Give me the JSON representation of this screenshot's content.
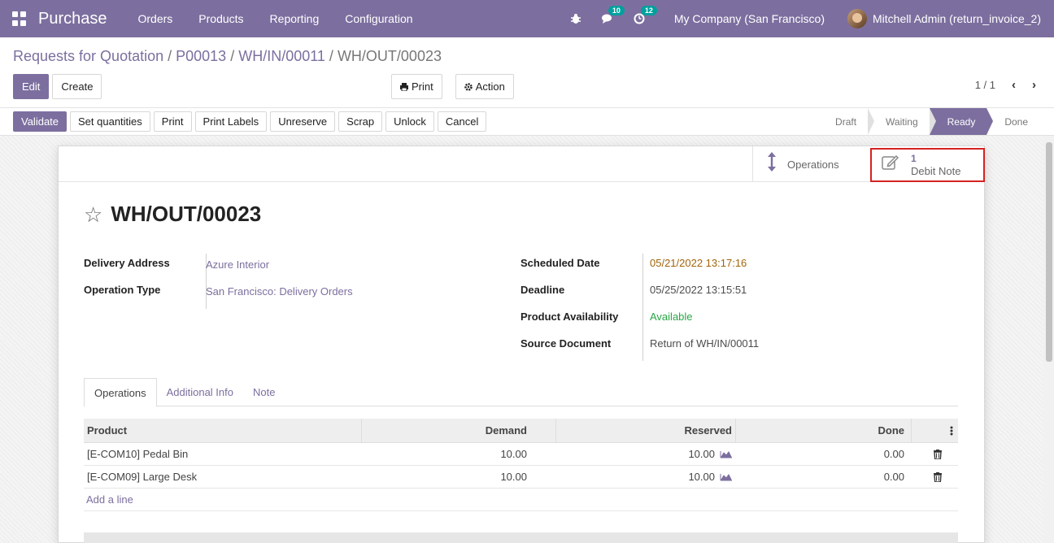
{
  "navbar": {
    "brand": "Purchase",
    "menu": [
      "Orders",
      "Products",
      "Reporting",
      "Configuration"
    ],
    "messages_count": "10",
    "activities_count": "12",
    "company": "My Company (San Francisco)",
    "user": "Mitchell Admin (return_invoice_2)"
  },
  "breadcrumb": [
    {
      "label": "Requests for Quotation"
    },
    {
      "label": "P00013"
    },
    {
      "label": "WH/IN/00011"
    },
    {
      "label": "WH/OUT/00023"
    }
  ],
  "control": {
    "edit": "Edit",
    "create": "Create",
    "print": "Print",
    "action": "Action",
    "pager": "1 / 1"
  },
  "status_buttons": {
    "validate": "Validate",
    "set_quantities": "Set quantities",
    "print": "Print",
    "print_labels": "Print Labels",
    "unreserve": "Unreserve",
    "scrap": "Scrap",
    "unlock": "Unlock",
    "cancel": "Cancel"
  },
  "stages": [
    "Draft",
    "Waiting",
    "Ready",
    "Done"
  ],
  "active_stage": "Ready",
  "smart_buttons": {
    "operations": "Operations",
    "debit_count": "1",
    "debit_label": "Debit Note"
  },
  "record": {
    "title": "WH/OUT/00023",
    "left": [
      {
        "label": "Delivery Address",
        "value": "Azure Interior"
      },
      {
        "label": "Operation Type",
        "value": "San Francisco: Delivery Orders"
      }
    ],
    "right": [
      {
        "label": "Scheduled Date",
        "value": "05/21/2022 13:17:16"
      },
      {
        "label": "Deadline",
        "value": "05/25/2022 13:15:51"
      },
      {
        "label": "Product Availability",
        "value": "Available"
      },
      {
        "label": "Source Document",
        "value": "Return of WH/IN/00011"
      }
    ]
  },
  "tabs": [
    "Operations",
    "Additional Info",
    "Note"
  ],
  "table": {
    "headers": {
      "product": "Product",
      "demand": "Demand",
      "reserved": "Reserved",
      "done": "Done"
    },
    "rows": [
      {
        "product": "[E-COM10] Pedal Bin",
        "demand": "10.00",
        "reserved": "10.00",
        "done": "0.00"
      },
      {
        "product": "[E-COM09] Large Desk",
        "demand": "10.00",
        "reserved": "10.00",
        "done": "0.00"
      }
    ],
    "add_line": "Add a line"
  },
  "colors": {
    "brand": "#7c6f9f",
    "badge": "#00a09d",
    "warning": "#a0640a",
    "success": "#28a745",
    "highlight": "#d62222"
  }
}
